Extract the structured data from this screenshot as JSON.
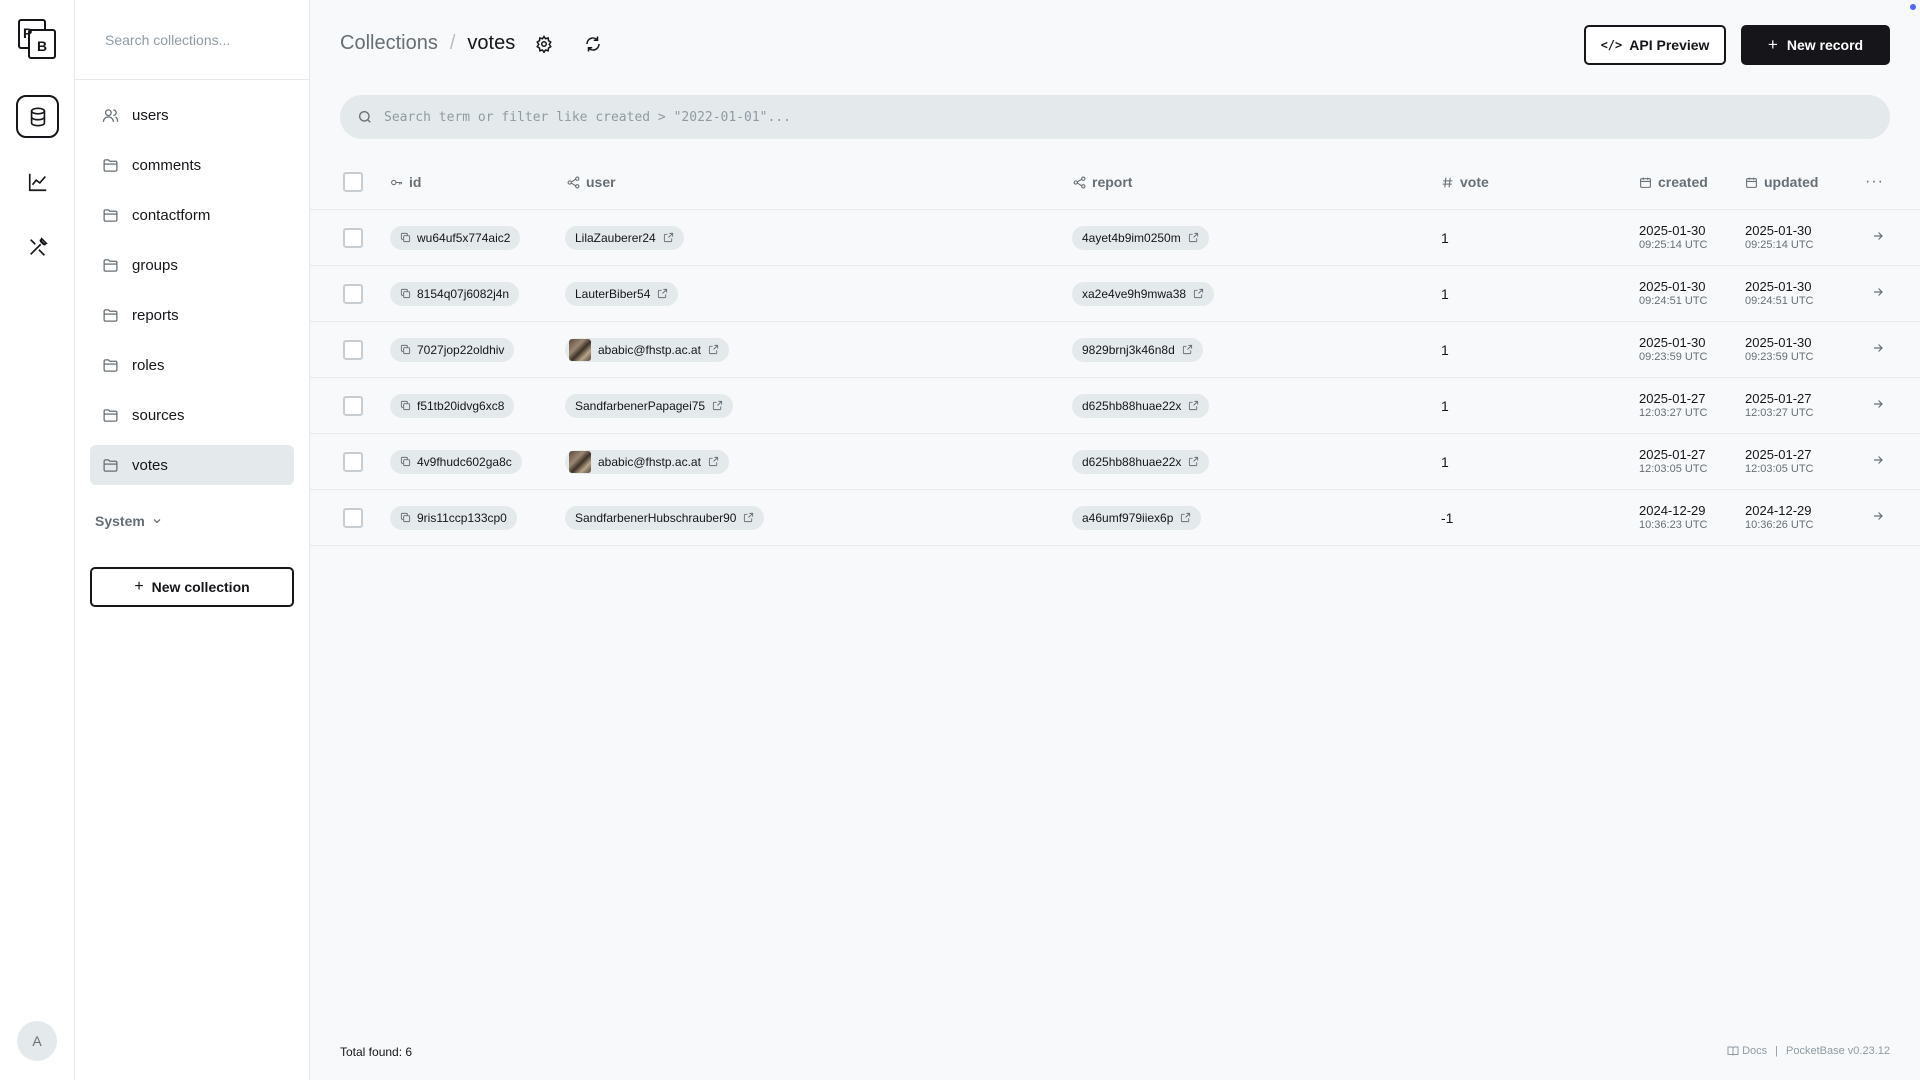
{
  "app": {
    "logo_text_top": "P",
    "logo_text_bottom": "B",
    "avatar_initial": "A"
  },
  "sidebar": {
    "search_placeholder": "Search collections...",
    "collections": [
      {
        "label": "users",
        "icon": "users-icon"
      },
      {
        "label": "comments",
        "icon": "folder-icon"
      },
      {
        "label": "contactform",
        "icon": "folder-icon"
      },
      {
        "label": "groups",
        "icon": "folder-icon"
      },
      {
        "label": "reports",
        "icon": "folder-icon"
      },
      {
        "label": "roles",
        "icon": "folder-icon"
      },
      {
        "label": "sources",
        "icon": "folder-icon"
      },
      {
        "label": "votes",
        "icon": "folder-icon",
        "active": true
      }
    ],
    "system_label": "System",
    "new_collection_label": "New collection"
  },
  "header": {
    "breadcrumb_parent": "Collections",
    "breadcrumb_sep": "/",
    "breadcrumb_current": "votes",
    "api_preview_label": "API Preview",
    "new_record_label": "New record"
  },
  "search": {
    "placeholder": "Search term or filter like created > \"2022-01-01\"..."
  },
  "table": {
    "columns": {
      "id": "id",
      "user": "user",
      "report": "report",
      "vote": "vote",
      "created": "created",
      "updated": "updated",
      "more": "···"
    },
    "rows": [
      {
        "id": "wu64uf5x774aic2",
        "user": "LilaZauberer24",
        "user_avatar": false,
        "report": "4ayet4b9im0250m",
        "vote": "1",
        "created_date": "2025-01-30",
        "created_time": "09:25:14 UTC",
        "updated_date": "2025-01-30",
        "updated_time": "09:25:14 UTC"
      },
      {
        "id": "8154q07j6082j4n",
        "user": "LauterBiber54",
        "user_avatar": false,
        "report": "xa2e4ve9h9mwa38",
        "vote": "1",
        "created_date": "2025-01-30",
        "created_time": "09:24:51 UTC",
        "updated_date": "2025-01-30",
        "updated_time": "09:24:51 UTC"
      },
      {
        "id": "7027jop22oldhiv",
        "user": "ababic@fhstp.ac.at",
        "user_avatar": true,
        "report": "9829brnj3k46n8d",
        "vote": "1",
        "created_date": "2025-01-30",
        "created_time": "09:23:59 UTC",
        "updated_date": "2025-01-30",
        "updated_time": "09:23:59 UTC"
      },
      {
        "id": "f51tb20idvg6xc8",
        "user": "SandfarbenerPapagei75",
        "user_avatar": false,
        "report": "d625hb88huae22x",
        "vote": "1",
        "created_date": "2025-01-27",
        "created_time": "12:03:27 UTC",
        "updated_date": "2025-01-27",
        "updated_time": "12:03:27 UTC"
      },
      {
        "id": "4v9fhudc602ga8c",
        "user": "ababic@fhstp.ac.at",
        "user_avatar": true,
        "report": "d625hb88huae22x",
        "vote": "1",
        "created_date": "2025-01-27",
        "created_time": "12:03:05 UTC",
        "updated_date": "2025-01-27",
        "updated_time": "12:03:05 UTC"
      },
      {
        "id": "9ris11ccp133cp0",
        "user": "SandfarbenerHubschrauber90",
        "user_avatar": false,
        "report": "a46umf979iiex6p",
        "vote": "-1",
        "created_date": "2024-12-29",
        "created_time": "10:36:23 UTC",
        "updated_date": "2024-12-29",
        "updated_time": "10:36:26 UTC"
      }
    ]
  },
  "footer": {
    "total_label": "Total found:",
    "total_count": "6",
    "docs_label": "Docs",
    "separator": "|",
    "version": "PocketBase v0.23.12"
  },
  "colors": {
    "accent": "#16161a",
    "muted": "#666f75",
    "surface": "#e4e9ec",
    "notification_dot": "#5065ff"
  }
}
